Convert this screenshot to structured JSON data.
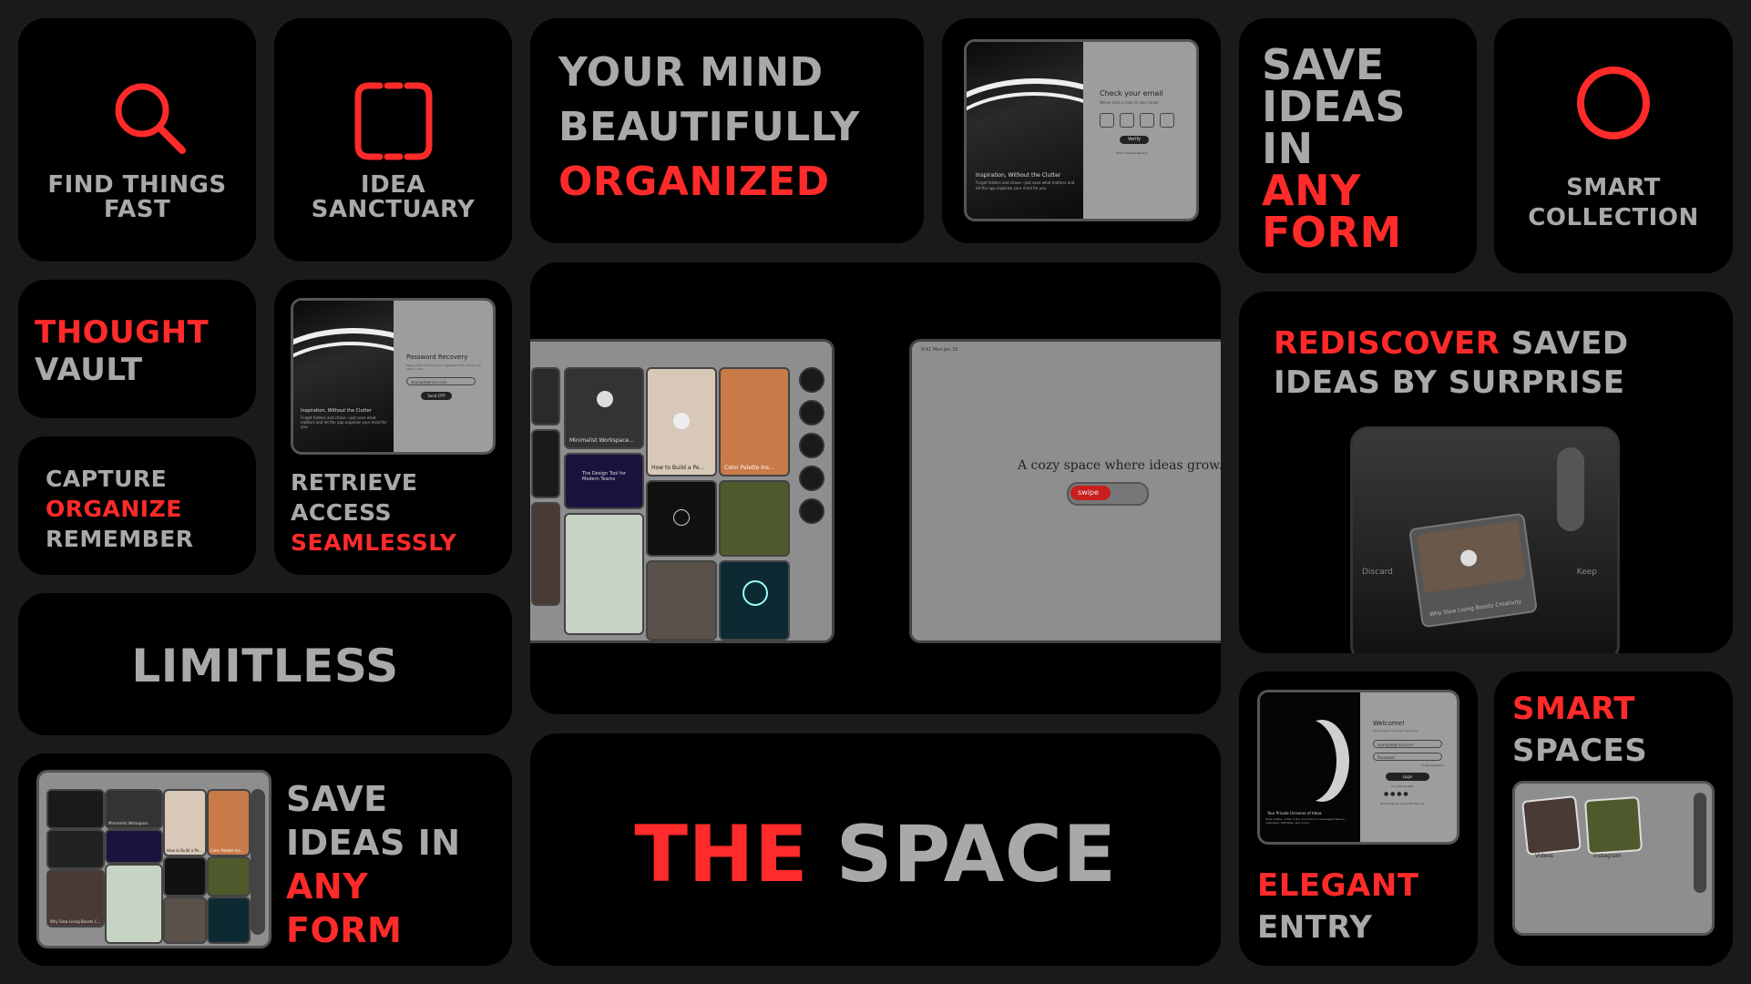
{
  "colors": {
    "accent": "#ff2a2a",
    "text": "#a9a9a9",
    "card": "#000000",
    "bg": "#1a1a1a"
  },
  "find": {
    "icon": "search-icon",
    "l1": "FIND THINGS",
    "l2": "FAST"
  },
  "idea": {
    "icon": "frame-icon",
    "l1": "IDEA",
    "l2": "SANCTUARY"
  },
  "mind": {
    "l1": "YOUR MIND",
    "l2": "BEAUTIFULLY",
    "l3": "ORGANIZED"
  },
  "email_screen": {
    "title": "Check your email",
    "sub": "We've sent a code to your email",
    "button": "Verify",
    "link": "Didn't receive? Resend",
    "caption_title": "Inspiration, Without the Clutter",
    "caption_body": "Forget folders and chaos—just save what matters and let the app organize your mind for you."
  },
  "save_any_top": {
    "l1": "SAVE",
    "l2": "IDEAS",
    "l3": "IN",
    "l4": "ANY",
    "l5": "FORM"
  },
  "smart_collection": {
    "icon": "circle-icon",
    "l1": "SMART",
    "l2": "COLLECTION"
  },
  "thought": {
    "l1": "THOUGHT",
    "l2": "VAULT"
  },
  "capture": {
    "l1": "CAPTURE",
    "l2": "ORGANIZE",
    "l3": "REMEMBER"
  },
  "password_screen": {
    "title": "Password Recovery",
    "sub": "Please enter the email you registered with and we will send a code",
    "field": "example@mail.com",
    "button": "Send OTP",
    "caption_title": "Inspiration, Without the Clutter",
    "caption_body": "Forget folders and chaos—just save what matters and let the app organize your mind for you."
  },
  "retrieve": {
    "l1": "RETRIEVE",
    "l2": "ACCESS",
    "l3": "SEAMLESSLY"
  },
  "gallery": {
    "tiles": [
      "Minimalist Workspace...",
      "How to Build a Pe...",
      "Color Palette Ins...",
      "The Design Tool for Modern Teams",
      "...s Cr..."
    ]
  },
  "cozy": {
    "topbar": "9:41  Mon Jan 15",
    "text": "A cozy space where ideas grow.",
    "swipe": "swipe"
  },
  "rediscover": {
    "l1a": "REDISCOVER",
    "l1b": "SAVED",
    "l2": "IDEAS BY SURPRISE",
    "discard": "Discard",
    "keep": "Keep",
    "card_caption": "Why Slow Living Boosts Creativity"
  },
  "limitless": {
    "text": "LIMITLESS"
  },
  "save_any_bottom": {
    "l1": "SAVE",
    "l2": "IDEAS IN",
    "l3": "ANY",
    "l4": "FORM",
    "tiles": [
      "Minimalist Workspace",
      "How to Build a Pe...",
      "Color Palette Ins...",
      "Why Slow Living Boosts C..."
    ]
  },
  "the_space": {
    "a": "THE",
    "b": "SPACE"
  },
  "welcome_screen": {
    "title": "Welcome!",
    "sub": "Please sign in to begin exploring",
    "email": "example@mail.com",
    "password": "Password",
    "forgot": "Forgot password",
    "button": "Login",
    "or": "or continue with",
    "signup": "Don't have an account? Sign up",
    "caption_title": "Your Private Universe of Ideas",
    "caption_body": "Save videos, notes, links, and more in one elegant space—organized, effortless, and yours."
  },
  "elegant": {
    "l1": "ELEGANT",
    "l2": "ENTRY"
  },
  "smart_spaces": {
    "l1": "SMART",
    "l2": "SPACES",
    "folders": [
      "Videos",
      "Instagram"
    ]
  }
}
